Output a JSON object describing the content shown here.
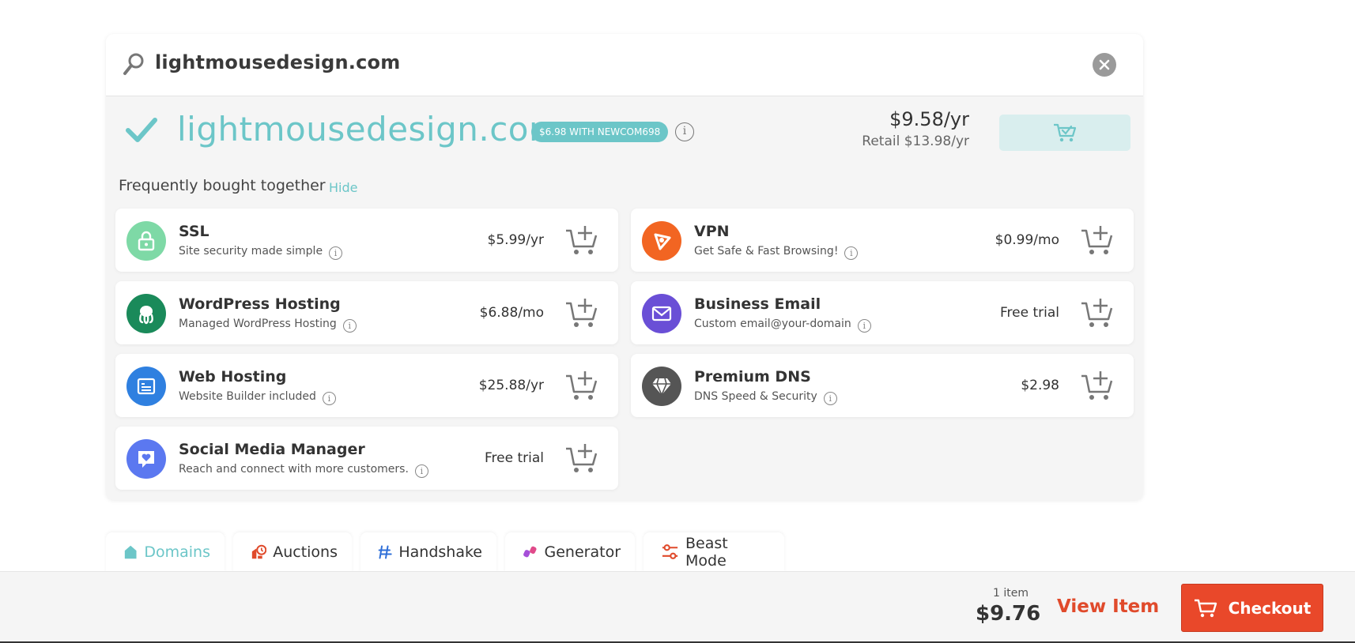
{
  "search": {
    "query": "lightmousedesign.com"
  },
  "result": {
    "domain": "lightmousedesign.com",
    "promo": "$6.98 WITH NEWCOM698",
    "info": "i",
    "price": "$9.58/yr",
    "retail": "Retail $13.98/yr"
  },
  "fbt": {
    "title": "Frequently bought together",
    "hide_label": "Hide",
    "items": [
      {
        "title": "SSL",
        "subtitle": "Site security made simple",
        "price": "$5.99/yr",
        "icon": "lock-icon",
        "color": "#7ed9a6",
        "info": "i"
      },
      {
        "title": "VPN",
        "subtitle": "Get Safe & Fast Browsing!",
        "price": "$0.99/mo",
        "icon": "vpn-icon",
        "color": "#f26522",
        "info": "i"
      },
      {
        "title": "WordPress Hosting",
        "subtitle": "Managed WordPress Hosting",
        "price": "$6.88/mo",
        "icon": "octopus-icon",
        "color": "#1a8a5a",
        "info": "i"
      },
      {
        "title": "Business Email",
        "subtitle": "Custom email@your-domain",
        "price": "Free trial",
        "icon": "envelope-icon",
        "color": "#6a4fd6",
        "info": "i"
      },
      {
        "title": "Web Hosting",
        "subtitle": "Website Builder included",
        "price": "$25.88/yr",
        "icon": "server-icon",
        "color": "#2f80e0",
        "info": "i"
      },
      {
        "title": "Premium DNS",
        "subtitle": "DNS Speed & Security",
        "price": "$2.98",
        "icon": "diamond-icon",
        "color": "#555555",
        "info": "i"
      },
      {
        "title": "Social Media Manager",
        "subtitle": "Reach and connect with more customers.",
        "price": "Free trial",
        "icon": "heart-chat-icon",
        "color": "#5b78f0",
        "info": "i"
      }
    ]
  },
  "tabs": [
    {
      "label": "Domains",
      "icon": "house-icon"
    },
    {
      "label": "Auctions",
      "icon": "auction-icon"
    },
    {
      "label": "Handshake",
      "icon": "handshake-icon"
    },
    {
      "label": "Generator",
      "icon": "generator-icon"
    },
    {
      "label": "Beast Mode",
      "icon": "sliders-icon"
    }
  ],
  "cart": {
    "item_count": "1 item",
    "total": "$9.76",
    "view_item_label": "View Item",
    "checkout_label": "Checkout"
  },
  "colors": {
    "accent": "#6cc6c8",
    "checkout": "#e9482a"
  }
}
